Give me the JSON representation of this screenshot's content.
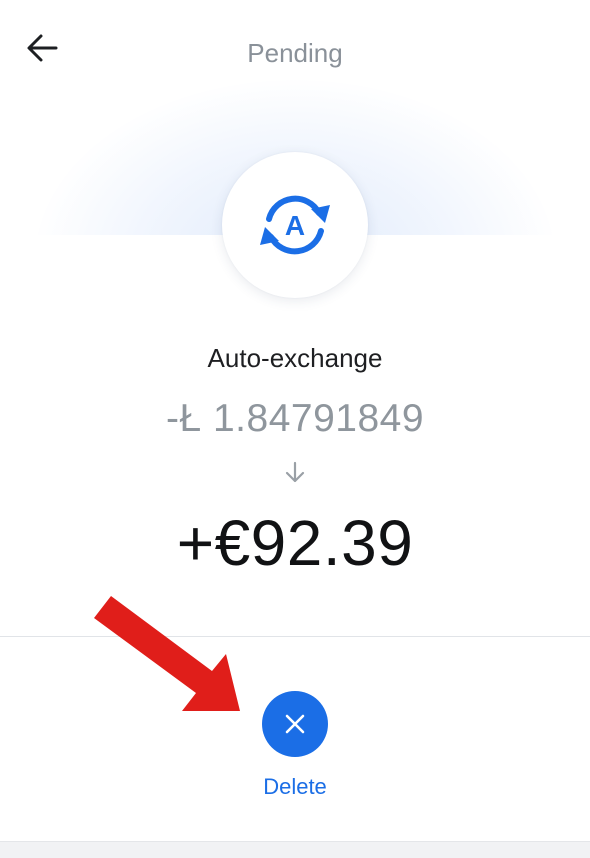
{
  "header": {
    "title": "Pending",
    "back_icon": "arrow-left-icon"
  },
  "transaction": {
    "icon": "auto-exchange-icon",
    "icon_letter": "A",
    "type_label": "Auto-exchange",
    "from_amount": "-Ł 1.84791849",
    "direction_icon": "arrow-down-icon",
    "to_amount": "+€92.39"
  },
  "actions": {
    "delete_label": "Delete",
    "delete_icon": "close-icon"
  },
  "annotation": {
    "overlay_icon": "red-pointer-arrow-icon"
  },
  "colors": {
    "accent": "#1b6ee6",
    "annotation": "#e01e1a",
    "muted_text": "#8f969d",
    "primary_text": "#111214"
  }
}
